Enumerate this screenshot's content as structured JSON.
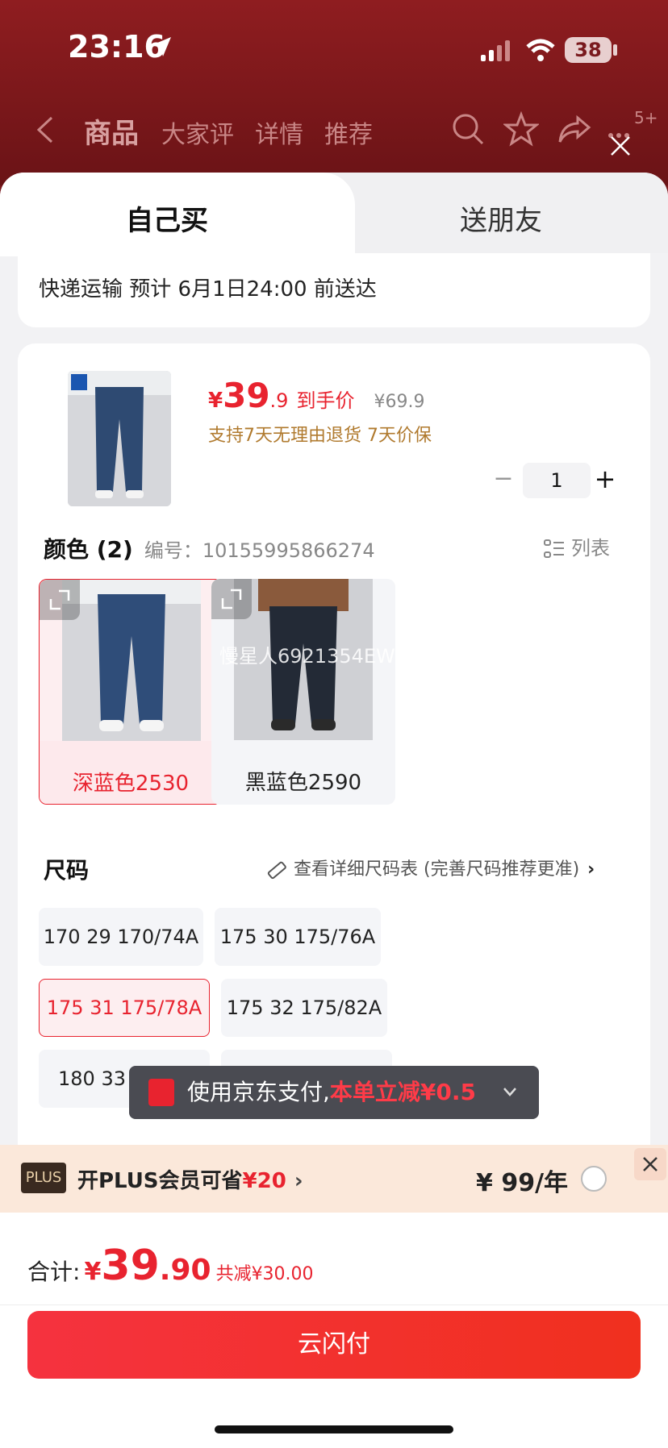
{
  "status_bar": {
    "time": "23:16",
    "battery": "38"
  },
  "nav": {
    "tabs": [
      "商品",
      "大家评",
      "详情",
      "推荐"
    ],
    "cart_badge": "5+"
  },
  "sheet": {
    "tabs": {
      "left": "自己买",
      "right": "送朋友"
    },
    "delivery": "快递运输 预计 6月1日24:00 前送达"
  },
  "product": {
    "price_symbol": "¥",
    "price_int": "39",
    "price_dec": ".9",
    "price_tag": "到手价",
    "price_original": "¥69.9",
    "guarantee": "支持7天无理由退货  7天价保",
    "quantity": "1",
    "minus": "−",
    "plus": "+"
  },
  "color": {
    "title": "颜色 (2)",
    "code": "编号：10155995866274",
    "list_toggle": "列表",
    "options": [
      "深蓝色2530",
      "黑蓝色2590"
    ],
    "selected": "深蓝色2530",
    "watermark": "慢星人6921354EW"
  },
  "size": {
    "title": "尺码",
    "guide": "查看详细尺码表 (完善尺码推荐更准)",
    "options": [
      "170 29 170/74A",
      "175 30 175/76A",
      "175 31 175/78A",
      "175 32 175/82A",
      "180 33"
    ],
    "selected": "175 31 175/78A"
  },
  "pay_toast": {
    "prefix": "使用京东支付,",
    "highlight": "本单立减¥0.5"
  },
  "plus_bar": {
    "badge": "PLUS",
    "text": "开PLUS会员可省",
    "amount": "¥20",
    "chevron": "›",
    "price": "¥ 99/年"
  },
  "total": {
    "label": "合计:",
    "symbol": "¥",
    "int": "39",
    "dec": ".90",
    "savings": "共减¥30.00"
  },
  "pay_button": "云闪付",
  "colors": {
    "accent": "#e8232f",
    "plus_bg": "#fbe8da",
    "header_bg": "#7a1a1e"
  }
}
